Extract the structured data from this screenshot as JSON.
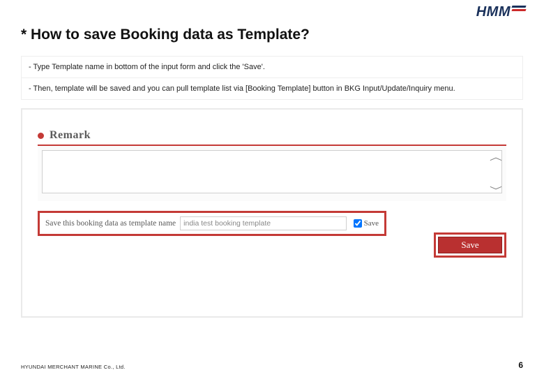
{
  "logo": {
    "text": "HMM"
  },
  "title": "* How to save Booking data as Template?",
  "instructions": [
    "Type Template name in bottom of the input form and click the 'Save'.",
    "Then, template will be saved and you can pull template list via [Booking Template] button in BKG Input/Update/Inquiry menu."
  ],
  "remark": {
    "heading": "Remark",
    "textarea_value": ""
  },
  "save_row": {
    "label": "Save this booking data as template name",
    "template_name_value": "india test booking template",
    "checkbox_checked": true,
    "checkbox_label": "Save"
  },
  "save_button": {
    "label": "Save"
  },
  "footer": {
    "company": "HYUNDAI MERCHANT MARINE Co., Ltd.",
    "page_number": "6"
  }
}
